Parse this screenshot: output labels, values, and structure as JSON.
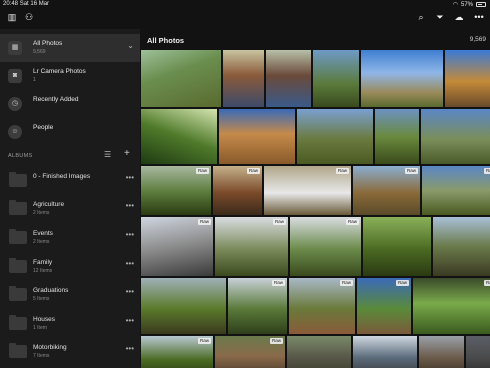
{
  "status": {
    "time": "20:48",
    "date": "Sat 16 Mar",
    "battery": "57%"
  },
  "icons": {
    "library": "library-icon",
    "people": "people-icon",
    "search": "search-icon",
    "filter": "filter-icon",
    "cloud": "cloud-sync-icon",
    "more": "more-icon"
  },
  "sidebar": {
    "nav": [
      {
        "title": "All Photos",
        "sub": "9,569",
        "icon": "▦",
        "active": true
      },
      {
        "title": "Lr Camera Photos",
        "sub": "1",
        "icon": "◙"
      },
      {
        "title": "Recently Added",
        "sub": "",
        "icon": "◷"
      },
      {
        "title": "People",
        "sub": "",
        "icon": "☺"
      }
    ],
    "albums_label": "ALBUMS",
    "albums": [
      {
        "name": "0 - Finished Images",
        "count": ""
      },
      {
        "name": "Agriculture",
        "count": "2 Items"
      },
      {
        "name": "Events",
        "count": "2 Items"
      },
      {
        "name": "Family",
        "count": "12 Items"
      },
      {
        "name": "Graduations",
        "count": "5 Items"
      },
      {
        "name": "Houses",
        "count": "1 Item"
      },
      {
        "name": "Motorbiking",
        "count": "7 Items"
      }
    ]
  },
  "main": {
    "title": "All Photos",
    "count": "9,569"
  },
  "photos": {
    "raw_label": "Raw",
    "rows": [
      [
        {
          "bg": "linear-gradient(160deg,#9fbf9a 0%,#6a8e4f 40%,#5a6a2e 100%)"
        },
        {
          "bg": "linear-gradient(180deg,#c8c4a0 0%,#8a5a3a 45%,#3d4a6a 100%)"
        },
        {
          "bg": "linear-gradient(180deg,#b8c0a8 0%,#6a4a3a 45%,#3a5a8a 100%)"
        },
        {
          "bg": "linear-gradient(180deg,#6e9ac6 0%,#5a7a3a 60%,#3a4a1e 100%)"
        },
        {
          "bg": "linear-gradient(180deg,#3f7fd0 0%,#8fb6e8 40%,#9a8a5a 75%,#5a6a2e 100%)"
        },
        {
          "bg": "linear-gradient(180deg,#3b7ad6 0%,#c48a3a 55%,#6a4a2a 100%)"
        }
      ],
      [
        {
          "bg": "linear-gradient(200deg,#d4e4b0 0%,#4f7a2a 50%,#1e3a12 100%)"
        },
        {
          "bg": "linear-gradient(180deg,#3a6ab8 0%,#c48a4a 45%,#8a5a2a 100%)"
        },
        {
          "bg": "linear-gradient(180deg,#7aa0d0 0%,#6a7a3e 55%,#4a5a22 100%)"
        },
        {
          "bg": "linear-gradient(180deg,#6c92c2 0%,#6a8a3e 50%,#3a4a1a 100%)"
        },
        {
          "bg": "linear-gradient(180deg,#5a86c6 0%,#7a8e5a 55%,#4a5a2a 100%)"
        }
      ],
      [
        {
          "bg": "linear-gradient(180deg,#a8b8a0 0%,#5a7a3a 55%,#2a3a12 100%)",
          "raw": true
        },
        {
          "bg": "linear-gradient(180deg,#c4b08a 0%,#7a4a2a 55%,#3a2a1a 100%)",
          "raw": true
        },
        {
          "bg": "linear-gradient(180deg,#b0a68a 0%,#e8e8e8 55%,#6a5a3a 100%)",
          "raw": true
        },
        {
          "bg": "linear-gradient(180deg,#8aaed0 0%,#8a6a3a 55%,#5a4a2a 100%)",
          "raw": true
        },
        {
          "bg": "linear-gradient(180deg,#5a86c6 0%,#8a9a6a 50%,#4a5a22 100%)",
          "raw": true
        }
      ],
      [
        {
          "bg": "linear-gradient(170deg,#cfd6e0 0%,#8a8a8a 50%,#3a3a3a 100%)",
          "raw": true
        },
        {
          "bg": "linear-gradient(180deg,#d8dce0 0%,#7a8a5a 55%,#3a4a1e 100%)",
          "raw": true
        },
        {
          "bg": "linear-gradient(180deg,#d8dce0 0%,#6a8a4a 55%,#3a4a1e 100%)",
          "raw": true
        },
        {
          "bg": "linear-gradient(180deg,#8ab05a 0%,#4a6a22 55%,#2a3a12 100%)"
        },
        {
          "bg": "linear-gradient(180deg,#a8c0d8 0%,#6a7a4a 50%,#3a3a22 100%)"
        }
      ],
      [
        {
          "bg": "linear-gradient(180deg,#a0b0b8 0%,#5a7a2a 55%,#3a3a1e 100%)"
        },
        {
          "bg": "linear-gradient(180deg,#c8d0d8 0%,#5a7a3a 55%,#2e3e1a 100%)",
          "raw": true
        },
        {
          "bg": "linear-gradient(180deg,#a8b8c8 0%,#6a7a3a 55%,#8a5a3a 100%)",
          "raw": true
        },
        {
          "bg": "linear-gradient(180deg,#3a6ab8 0%,#5a8a3a 55%,#7a5a3a 100%)",
          "raw": true
        },
        {
          "bg": "linear-gradient(180deg,#3a4a2a 0%,#7aaa4a 45%,#3a5a1e 100%)",
          "raw": true
        }
      ],
      [
        {
          "bg": "linear-gradient(180deg,#b8c8d0 0%,#4a6a22 60%,#2a3a12 100%)",
          "raw": true
        },
        {
          "bg": "linear-gradient(180deg,#6a7a4a 0%,#8a6a4a 50%,#4a3a2a 100%)",
          "raw": true
        },
        {
          "bg": "linear-gradient(180deg,#7a8a6a 0%,#5a5a4a 50%,#3a3a2a 100%)"
        },
        {
          "bg": "linear-gradient(180deg,#cfd8e0 0%,#5a6a7a 55%,#3a3a3a 100%)"
        },
        {
          "bg": "linear-gradient(180deg,#9aa0a8 0%,#6a5a4a 55%,#3a2e22 100%)"
        },
        {
          "bg": "linear-gradient(180deg,#5a5e66 0%,#4a4a4a 55%,#2a2a2a 100%)"
        }
      ]
    ]
  }
}
